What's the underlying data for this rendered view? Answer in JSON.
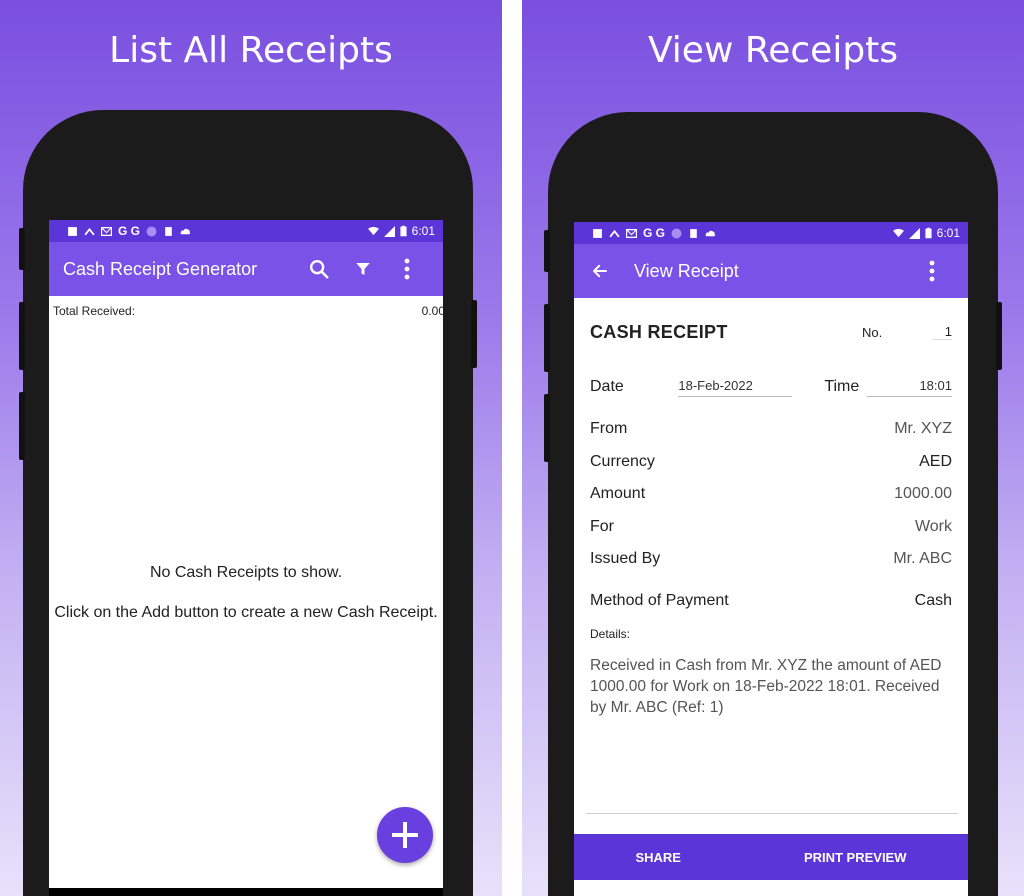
{
  "colors": {
    "accent": "#7a52e8",
    "status_bar": "#5c35d9",
    "fab": "#6a3fe0"
  },
  "left": {
    "caption": "List All Receipts",
    "status": {
      "icons_text": "G G",
      "time": "6:01"
    },
    "appbar": {
      "title": "Cash Receipt Generator",
      "icons": [
        "search-icon",
        "filter-icon",
        "more-vert-icon"
      ]
    },
    "total": {
      "label": "Total Received:",
      "value": "0.00"
    },
    "empty": {
      "line1": "No Cash Receipts to show.",
      "line2": "Click on the Add button to create a new Cash Receipt."
    },
    "fab_icon": "add-icon"
  },
  "right": {
    "caption": "View Receipts",
    "status": {
      "icons_text": "G G",
      "time": "6:01"
    },
    "appbar": {
      "title": "View Receipt",
      "icons": [
        "back-arrow-icon",
        "more-vert-icon"
      ]
    },
    "receipt": {
      "title": "CASH RECEIPT",
      "no_label": "No.",
      "no_value": "1",
      "date_label": "Date",
      "date_value": "18-Feb-2022",
      "time_label": "Time",
      "time_value": "18:01",
      "fields": [
        {
          "label": "From",
          "value": "Mr. XYZ"
        },
        {
          "label": "Currency",
          "value": "AED"
        },
        {
          "label": "Amount",
          "value": "1000.00"
        },
        {
          "label": "For",
          "value": "Work"
        },
        {
          "label": "Issued By",
          "value": "Mr. ABC"
        }
      ],
      "method_label": "Method of Payment",
      "method_value": "Cash",
      "details_label": "Details:",
      "details_text": "Received in Cash from Mr. XYZ the amount of AED 1000.00 for Work on 18-Feb-2022 18:01. Received by Mr. ABC (Ref: 1)"
    },
    "actions": {
      "share": "SHARE",
      "print_preview": "PRINT PREVIEW"
    }
  }
}
